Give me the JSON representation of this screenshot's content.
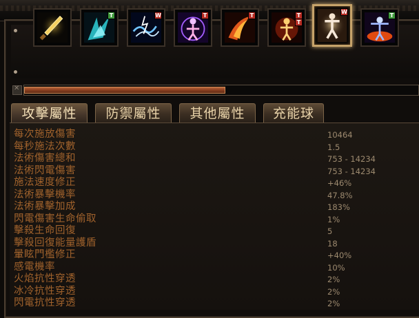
{
  "skills": [
    {
      "icon": "sword-icon",
      "gems": []
    },
    {
      "icon": "ice-shard-icon",
      "gems": [
        {
          "letter": "T",
          "color": "#3f9a3c"
        }
      ]
    },
    {
      "icon": "lightning-icon",
      "gems": [
        {
          "letter": "W",
          "color": "#b72b22"
        }
      ]
    },
    {
      "icon": "arcane-figure-icon",
      "gems": [
        {
          "letter": "T",
          "color": "#b72b22"
        }
      ]
    },
    {
      "icon": "fire-slash-icon",
      "gems": [
        {
          "letter": "T",
          "color": "#b72b22"
        }
      ]
    },
    {
      "icon": "fire-aura-icon",
      "gems": [
        {
          "letter": "T",
          "color": "#b72b22"
        },
        {
          "letter": "T",
          "color": "#b72b22"
        }
      ]
    },
    {
      "icon": "body-glow-icon",
      "gems": [
        {
          "letter": "W",
          "color": "#b72b22"
        }
      ],
      "selected": true
    },
    {
      "icon": "flame-figure-icon",
      "gems": [
        {
          "letter": "T",
          "color": "#3f9a3c"
        }
      ]
    }
  ],
  "scroll": {
    "position": 0.51
  },
  "tabs": [
    "攻擊屬性",
    "防禦屬性",
    "其他屬性",
    "充能球"
  ],
  "active_tab": 0,
  "stats": [
    {
      "label": "每次施放傷害",
      "value": "10464"
    },
    {
      "label": "每秒施法次數",
      "value": "1.5"
    },
    {
      "label": "法術傷害總和",
      "value": "753 - 14234"
    },
    {
      "label": "法術閃電傷害",
      "value": "753 - 14234"
    },
    {
      "label": "施法速度修正",
      "value": "+46%"
    },
    {
      "label": "法術暴擊機率",
      "value": "47.8%"
    },
    {
      "label": "法術暴擊加成",
      "value": "183%"
    },
    {
      "label": "閃電傷害生命偷取",
      "value": "1%"
    },
    {
      "label": "擊殺生命回復",
      "value": "5"
    },
    {
      "label": "擊殺回復能量護盾",
      "value": "18"
    },
    {
      "label": "暈眩門檻修正",
      "value": "+40%"
    },
    {
      "label": "感電機率",
      "value": "10%"
    },
    {
      "label": "火焰抗性穿透",
      "value": "2%"
    },
    {
      "label": "冰冷抗性穿透",
      "value": "2%"
    },
    {
      "label": "閃電抗性穿透",
      "value": "2%"
    }
  ]
}
